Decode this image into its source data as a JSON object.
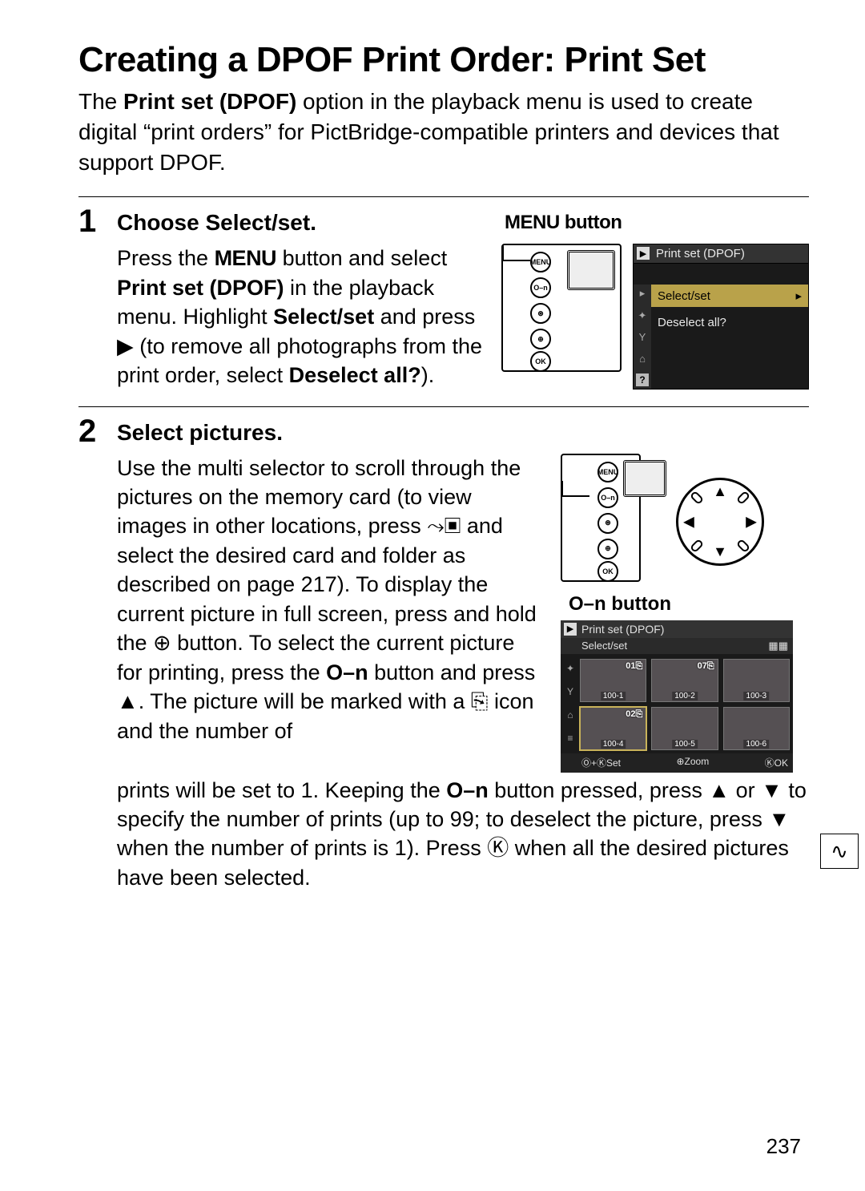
{
  "title": "Creating a DPOF Print Order: Print Set",
  "intro_html": "The <b>Print set (DPOF)</b> option in the playback menu is used to create digital “print orders” for PictBridge-compatible printers and devices that support DPOF.",
  "steps": {
    "s1": {
      "num": "1",
      "title": "Choose Select/set.",
      "menu_caption": "MENU button",
      "body_html": "Press the <span class='menu-word'>MENU</span> button and select <b>Print set (DPOF)</b> in the playback menu. Highlight <b>Select/set</b> and press <span class='glyph'>▶</span> (to remove all photographs from the print order, select <b>Deselect all?</b>).",
      "lcd": {
        "title": "Print set (DPOF)",
        "hl": "Select/set",
        "sub": "Deselect all?"
      }
    },
    "s2": {
      "num": "2",
      "title": "Select pictures.",
      "button_caption_prefix": "O–n",
      "button_caption": " button",
      "body_html": "Use the multi selector to scroll through the pictures on the memory card (to view images in other locations, press <span class='glyph'>⤳▣</span> and select the desired card and folder as described on page 217).  To display the current picture in full screen, press and hold the <span class='glyph'>⊕</span> button.  To select the current picture for printing, press the <b>O–n</b> button and press <span class='glyph'>▲</span>.  The picture will be marked with a <span class='glyph'>⎘</span> icon and the number of",
      "cont_html": "prints will be set to 1.  Keeping the <b>O–n</b> button pressed, press <span class='glyph'>▲</span> or <span class='glyph'>▼</span> to specify the number of prints (up to 99; to deselect the picture, press <span class='glyph'>▼</span> when the number of prints is 1).  Press <span class='glyph'>Ⓚ</span> when all the desired pictures have been selected.",
      "lcd": {
        "title": "Print set (DPOF)",
        "sub": "Select/set",
        "thumbs": [
          {
            "label": "100-1",
            "badge": "01⎘"
          },
          {
            "label": "100-2",
            "badge": "07⎘"
          },
          {
            "label": "100-3",
            "badge": ""
          },
          {
            "label": "100-4",
            "badge": "02⎘",
            "sel": true
          },
          {
            "label": "100-5",
            "badge": ""
          },
          {
            "label": "100-6",
            "badge": ""
          }
        ],
        "footer": {
          "set": "Ⓞ+ⓀSet",
          "zoom": "⊕Zoom",
          "ok": "ⓀOK"
        }
      }
    }
  },
  "side_tab_icon": "↻",
  "page_number": "237",
  "cam_buttons": {
    "b1": "MENU",
    "b2": "O–n",
    "b3": "⊛",
    "b4": "⊕",
    "b5": "OK"
  }
}
